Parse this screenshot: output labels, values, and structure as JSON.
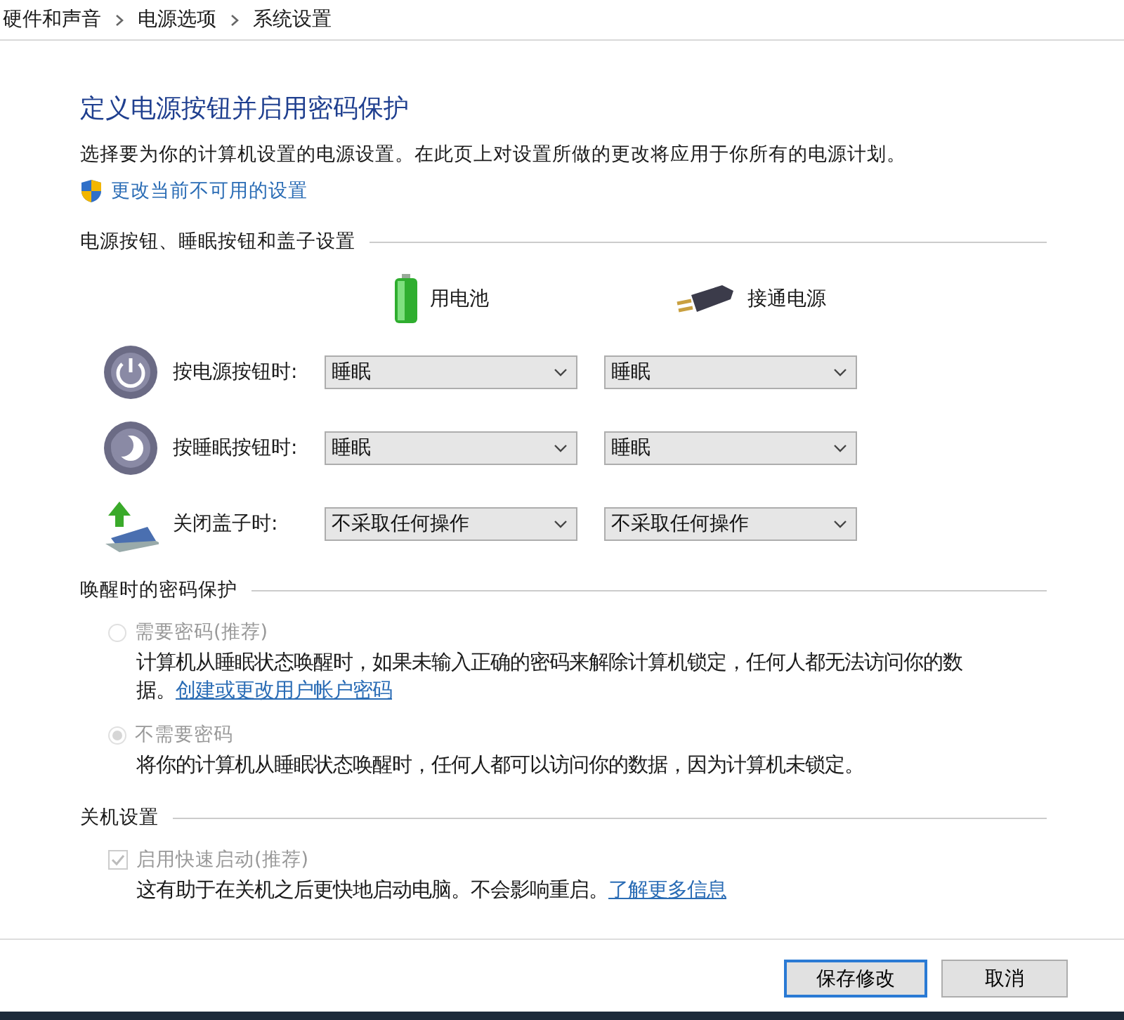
{
  "breadcrumb": [
    "硬件和声音",
    "电源选项",
    "系统设置"
  ],
  "heading": "定义电源按钮并启用密码保护",
  "description": "选择要为你的计算机设置的电源设置。在此页上对设置所做的更改将应用于你所有的电源计划。",
  "admin_link": "更改当前不可用的设置",
  "button_section": {
    "title": "电源按钮、睡眠按钮和盖子设置",
    "columns": [
      {
        "label": "用电池",
        "kind": "battery"
      },
      {
        "label": "接通电源",
        "kind": "plug"
      }
    ],
    "rows": [
      {
        "kind": "power",
        "label": "按电源按钮时:",
        "values": [
          "睡眠",
          "睡眠"
        ]
      },
      {
        "kind": "sleep",
        "label": "按睡眠按钮时:",
        "values": [
          "睡眠",
          "睡眠"
        ]
      },
      {
        "kind": "lid",
        "label": "关闭盖子时:",
        "values": [
          "不采取任何操作",
          "不采取任何操作"
        ]
      }
    ]
  },
  "password_section": {
    "title": "唤醒时的密码保护",
    "options": [
      {
        "label": "需要密码(推荐)",
        "selected": false,
        "disabled": true,
        "description": "计算机从睡眠状态唤醒时，如果未输入正确的密码来解除计算机锁定，任何人都无法访问你的数据。",
        "link": "创建或更改用户帐户密码"
      },
      {
        "label": "不需要密码",
        "selected": true,
        "disabled": true,
        "description": "将你的计算机从睡眠状态唤醒时，任何人都可以访问你的数据，因为计算机未锁定。"
      }
    ]
  },
  "shutdown_section": {
    "title": "关机设置",
    "checkbox": {
      "label": "启用快速启动(推荐)",
      "checked": true,
      "disabled": true,
      "description": "这有助于在关机之后更快地启动电脑。不会影响重启。",
      "link": "了解更多信息"
    }
  },
  "buttons": [
    {
      "label": "保存修改",
      "kind": "default"
    },
    {
      "label": "取消",
      "kind": "normal"
    }
  ]
}
